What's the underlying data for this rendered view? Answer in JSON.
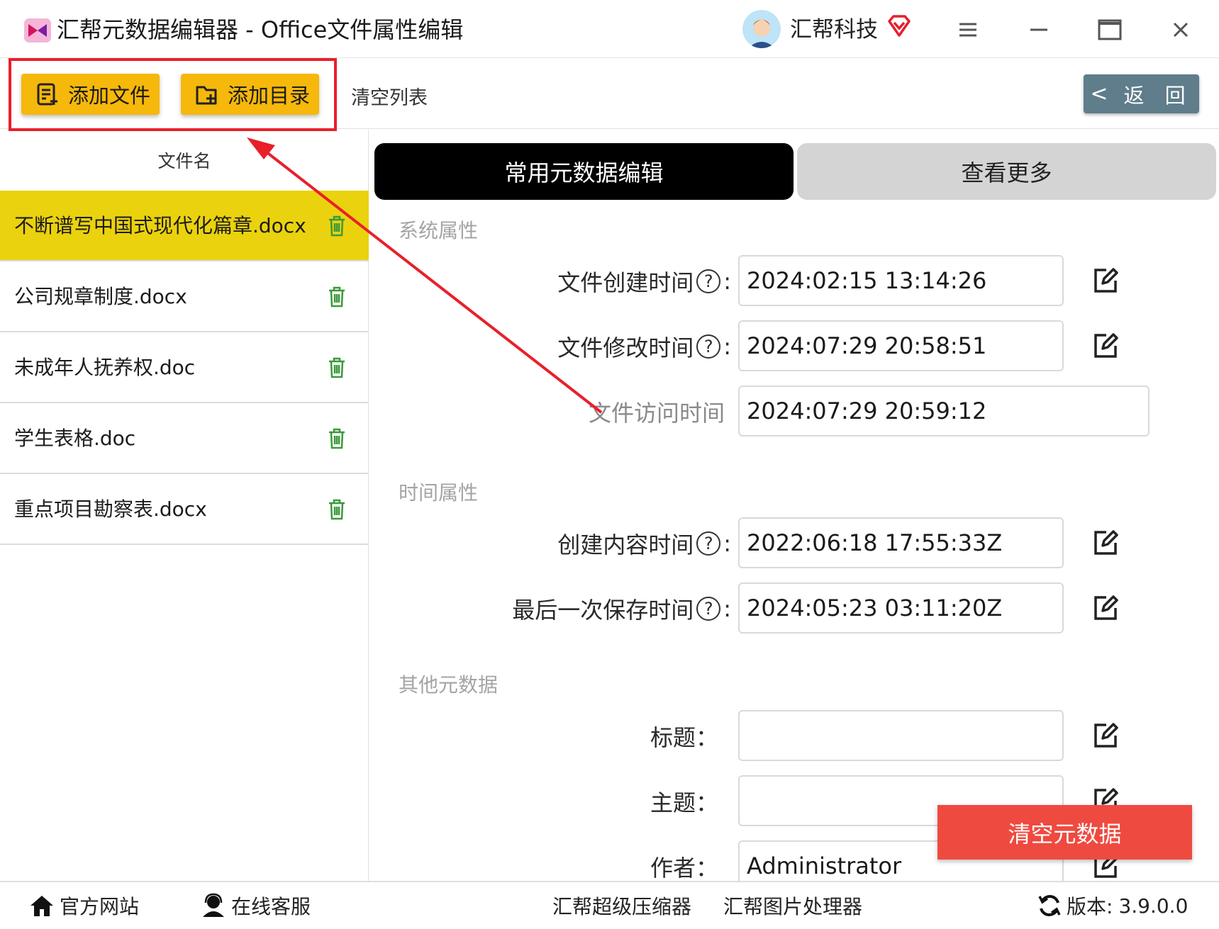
{
  "window": {
    "title": "汇帮元数据编辑器 - Office文件属性编辑",
    "brand": "汇帮科技"
  },
  "toolbar": {
    "add_file": "添加文件",
    "add_folder": "添加目录",
    "clear_list": "清空列表",
    "back": "返 回"
  },
  "file_list": {
    "header": "文件名",
    "files": [
      "不断谱写中国式现代化篇章.docx",
      "公司规章制度.docx",
      "未成年人抚养权.doc",
      "学生表格.doc",
      "重点项目勘察表.docx"
    ]
  },
  "tabs": {
    "common": "常用元数据编辑",
    "more": "查看更多"
  },
  "sections": {
    "system": "系统属性",
    "time": "时间属性",
    "other": "其他元数据"
  },
  "fields": {
    "created": {
      "label": "文件创建时间",
      "value": "2024:02:15 13:14:26"
    },
    "modified": {
      "label": "文件修改时间",
      "value": "2024:07:29 20:58:51"
    },
    "accessed": {
      "label": "文件访问时间",
      "value": "2024:07:29 20:59:12"
    },
    "content_created": {
      "label": "创建内容时间",
      "value": "2022:06:18 17:55:33Z"
    },
    "last_saved": {
      "label": "最后一次保存时间",
      "value": "2024:05:23 03:11:20Z"
    },
    "title": {
      "label": "标题：",
      "value": ""
    },
    "subject": {
      "label": "主题：",
      "value": ""
    },
    "author": {
      "label": "作者：",
      "value": "Administrator"
    }
  },
  "clear_metadata": "清空元数据",
  "statusbar": {
    "website": "官方网站",
    "support": "在线客服",
    "compressor": "汇帮超级压缩器",
    "image_tool": "汇帮图片处理器",
    "version_label": "版本:",
    "version": "3.9.0.0"
  },
  "colors": {
    "accent_yellow": "#f6b80a",
    "selected_row": "#ebd20e",
    "danger": "#ef4a40",
    "annotation_red": "#e8202a",
    "back_button": "#5f7d8b"
  }
}
